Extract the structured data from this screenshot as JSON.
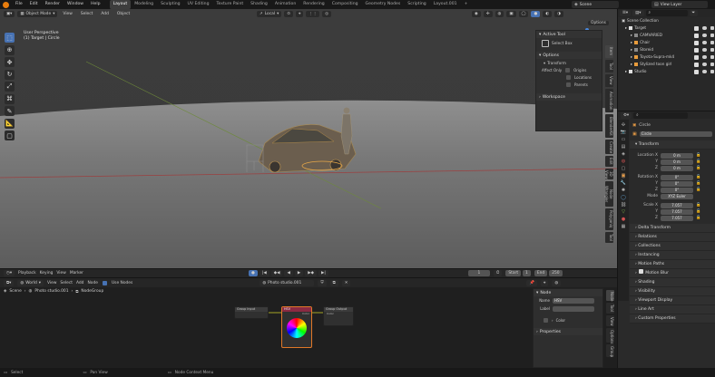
{
  "topbar": {
    "menus": [
      "File",
      "Edit",
      "Render",
      "Window",
      "Help"
    ],
    "workspaces": [
      "Layout",
      "Modeling",
      "Sculpting",
      "UV Editing",
      "Texture Paint",
      "Shading",
      "Animation",
      "Rendering",
      "Compositing",
      "Geometry Nodes",
      "Scripting",
      "Layout.001"
    ],
    "active_workspace": "Layout",
    "scene": "Scene",
    "view_layer": "View Layer"
  },
  "viewport": {
    "mode": "Object Mode",
    "menus": [
      "View",
      "Select",
      "Add",
      "Object"
    ],
    "orientation": "Local",
    "overlay_title": "User Perspective",
    "overlay_sub": "(1) Target | Circle",
    "options_label": "Options",
    "side_tabs": [
      "Item",
      "Tool",
      "View",
      "Animation",
      "BlenderKit",
      "Create",
      "Edit",
      "3D Viewport Pie Menus",
      "Node Wrangler",
      "Polygoniq",
      "Tool"
    ]
  },
  "npanel": {
    "active_tool_header": "Active Tool",
    "tool_name": "Select Box",
    "options_header": "Options",
    "transform_header": "Transform",
    "affect_only_label": "Affect Only",
    "affect_only": [
      "Origins",
      "Locations",
      "Parents"
    ],
    "workspace_header": "Workspace"
  },
  "timeline": {
    "menus": [
      "Playback",
      "Keying",
      "View",
      "Marker"
    ],
    "current_frame": "1",
    "start_label": "Start",
    "start": "1",
    "end_label": "End",
    "end": "250"
  },
  "node_editor": {
    "mode": "World",
    "menus": [
      "View",
      "Select",
      "Add",
      "Node"
    ],
    "use_nodes_label": "Use Nodes",
    "node_tree_name": "Photo studio.001",
    "breadcrumb": [
      "Scene",
      "Photo studio.001",
      "NodeGroup"
    ],
    "nodes": {
      "group_input": "Group Input",
      "hsv": "HSV",
      "group_output": "Group Output",
      "color_port": "Color",
      "fac_port": "Color"
    },
    "sidebar": {
      "node_header": "Node",
      "name_label": "Name",
      "name_value": "HSV",
      "label_label": "Label",
      "color_header": "Color",
      "properties_header": "Properties"
    },
    "side_tabs": [
      "Node",
      "Tool",
      "View",
      "Options",
      "Group"
    ]
  },
  "outliner": {
    "title": "Scene Collection",
    "items": [
      {
        "label": "Target",
        "indent": 1,
        "swatch": "#e0e0e0"
      },
      {
        "label": "CAMVARIED",
        "indent": 2,
        "swatch": "#8a8a8a"
      },
      {
        "label": "Chair",
        "indent": 2,
        "swatch": "#e89c3c"
      },
      {
        "label": "Storeid",
        "indent": 2,
        "swatch": "#8a8a8a"
      },
      {
        "label": "Toyota-Supra-mk4",
        "indent": 2,
        "swatch": "#e89c3c"
      },
      {
        "label": "Stylized toon girl",
        "indent": 2,
        "swatch": "#e89c3c"
      },
      {
        "label": "Studio",
        "indent": 1,
        "swatch": "#e0e0e0"
      }
    ]
  },
  "properties": {
    "object_name": "Circle",
    "object_name_field": "Circle",
    "transform_header": "Transform",
    "location_label": "Location X",
    "location": [
      "0 m",
      "0 m",
      "0 m"
    ],
    "rotation_label": "Rotation X",
    "rotation": [
      "0°",
      "0°",
      "0°"
    ],
    "mode_label": "Mode",
    "mode_value": "XYZ Euler",
    "scale_label": "Scale X",
    "scale": [
      "7.057",
      "7.057",
      "7.057"
    ],
    "axes": [
      "Y",
      "Z"
    ],
    "sections": [
      "Delta Transform",
      "Relations",
      "Collections",
      "Instancing",
      "Motion Paths",
      "Motion Blur",
      "Shading",
      "Visibility",
      "Viewport Display",
      "Line Art",
      "Custom Properties"
    ]
  },
  "statusbar": {
    "items": [
      "Select",
      "Pan View",
      "Node Context Menu"
    ]
  }
}
